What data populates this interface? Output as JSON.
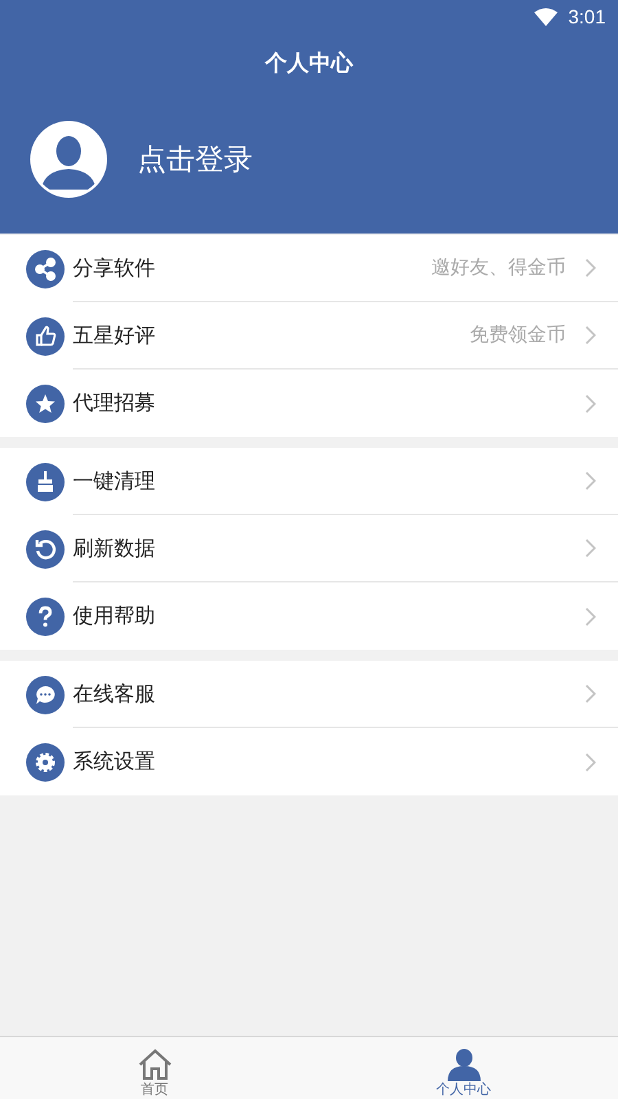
{
  "status_bar": {
    "time": "3:01"
  },
  "header": {
    "title": "个人中心",
    "login_label": "点击登录"
  },
  "menu_groups": [
    {
      "items": [
        {
          "kind": "share",
          "label": "分享软件",
          "hint": "邀好友、得金币"
        },
        {
          "kind": "thumb",
          "label": "五星好评",
          "hint": "免费领金币"
        },
        {
          "kind": "star",
          "label": "代理招募"
        }
      ]
    },
    {
      "items": [
        {
          "kind": "broom",
          "label": "一键清理"
        },
        {
          "kind": "refresh",
          "label": "刷新数据"
        },
        {
          "kind": "help",
          "label": "使用帮助"
        }
      ]
    },
    {
      "items": [
        {
          "kind": "chat",
          "label": "在线客服"
        },
        {
          "kind": "gear",
          "label": "系统设置"
        }
      ]
    }
  ],
  "tab_bar": [
    {
      "kind": "home",
      "label": "首页",
      "selected": false
    },
    {
      "kind": "person",
      "label": "个人中心",
      "selected": true
    }
  ]
}
